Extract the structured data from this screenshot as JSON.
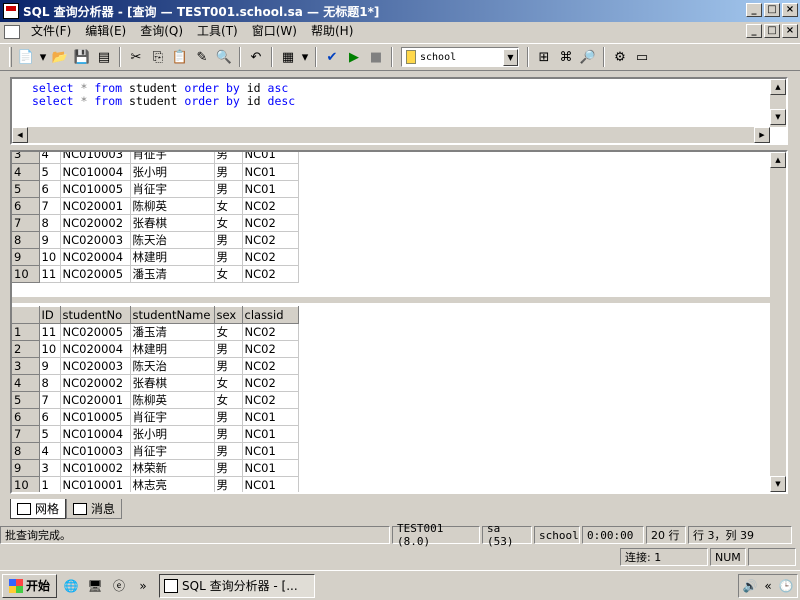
{
  "window": {
    "title": "SQL 查询分析器 - [查询 — TEST001.school.sa — 无标题1*]",
    "minimize": "_",
    "maximize": "□",
    "close": "×"
  },
  "menu": {
    "items": [
      "文件(F)",
      "编辑(E)",
      "查询(Q)",
      "工具(T)",
      "窗口(W)",
      "帮助(H)"
    ]
  },
  "toolbar": {
    "database": "school"
  },
  "editor": {
    "line1": {
      "kw1": "select",
      "op": "*",
      "kw2": "from",
      "table": "student",
      "kw3": "order by",
      "col": "id",
      "kw4": "asc"
    },
    "line2": {
      "kw1": "select",
      "op": "*",
      "kw2": "from",
      "table": "student",
      "kw3": "order by",
      "col": "id",
      "kw4": "desc"
    }
  },
  "result1": {
    "rows": [
      [
        "3",
        "4",
        "NC010003",
        "肖征宇",
        "男",
        "NC01"
      ],
      [
        "4",
        "5",
        "NC010004",
        "张小明",
        "男",
        "NC01"
      ],
      [
        "5",
        "6",
        "NC010005",
        "肖征宇",
        "男",
        "NC01"
      ],
      [
        "6",
        "7",
        "NC020001",
        "陈柳英",
        "女",
        "NC02"
      ],
      [
        "7",
        "8",
        "NC020002",
        "张春棋",
        "女",
        "NC02"
      ],
      [
        "8",
        "9",
        "NC020003",
        "陈天治",
        "男",
        "NC02"
      ],
      [
        "9",
        "10",
        "NC020004",
        "林建明",
        "男",
        "NC02"
      ],
      [
        "10",
        "11",
        "NC020005",
        "潘玉清",
        "女",
        "NC02"
      ]
    ]
  },
  "result2": {
    "columns": [
      "ID",
      "studentNo",
      "studentName",
      "sex",
      "classid"
    ],
    "rows": [
      [
        "1",
        "11",
        "NC020005",
        "潘玉清",
        "女",
        "NC02"
      ],
      [
        "2",
        "10",
        "NC020004",
        "林建明",
        "男",
        "NC02"
      ],
      [
        "3",
        "9",
        "NC020003",
        "陈天治",
        "男",
        "NC02"
      ],
      [
        "4",
        "8",
        "NC020002",
        "张春棋",
        "女",
        "NC02"
      ],
      [
        "5",
        "7",
        "NC020001",
        "陈柳英",
        "女",
        "NC02"
      ],
      [
        "6",
        "6",
        "NC010005",
        "肖征宇",
        "男",
        "NC01"
      ],
      [
        "7",
        "5",
        "NC010004",
        "张小明",
        "男",
        "NC01"
      ],
      [
        "8",
        "4",
        "NC010003",
        "肖征宇",
        "男",
        "NC01"
      ],
      [
        "9",
        "3",
        "NC010002",
        "林荣新",
        "男",
        "NC01"
      ],
      [
        "10",
        "1",
        "NC010001",
        "林志亮",
        "男",
        "NC01"
      ]
    ]
  },
  "tabs": {
    "grid": "网格",
    "messages": "消息"
  },
  "status": {
    "message": "批查询完成。",
    "server": "TEST001 (8.0)",
    "user": "sa (53)",
    "db": "school",
    "time": "0:00:00",
    "rows": "20 行",
    "position": "行 3，列 39",
    "connections": "连接: 1",
    "num": "NUM"
  },
  "taskbar": {
    "start": "开始",
    "chevron": "»",
    "app": "SQL 查询分析器 - [...",
    "tray_chevron": "«"
  }
}
